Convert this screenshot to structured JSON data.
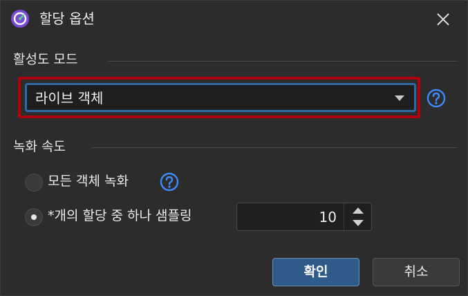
{
  "window": {
    "title": "할당 옵션",
    "close_icon": "close-icon",
    "app_icon": "gauge-app-icon"
  },
  "activity_mode": {
    "section_label": "활성도 모드",
    "selected_value": "라이브 객체",
    "help_icon": "help-icon"
  },
  "recording_speed": {
    "section_label": "녹화 속도",
    "options": [
      {
        "label": "모든 객체 녹화",
        "checked": false
      },
      {
        "label": "*개의 할당 중 하나 샘플링",
        "checked": true
      }
    ],
    "sample_value": "10"
  },
  "buttons": {
    "ok_label": "확인",
    "cancel_label": "취소"
  },
  "colors": {
    "accent": "#2f6aa6",
    "highlight": "#b0000b",
    "help": "#3d8bff",
    "app_icon": "#7b4ad8"
  }
}
